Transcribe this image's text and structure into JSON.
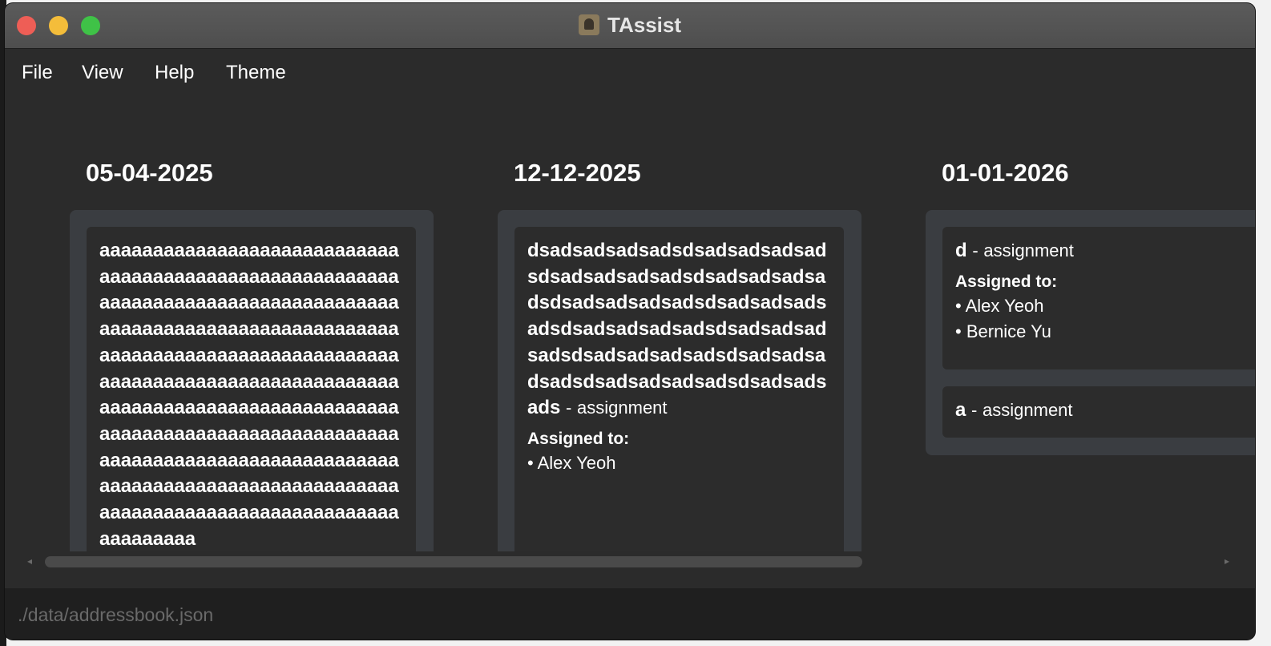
{
  "window": {
    "title": "TAssist"
  },
  "menu": [
    "File",
    "View",
    "Help",
    "Theme"
  ],
  "columns": [
    {
      "date": "05-04-2025",
      "cards": [
        {
          "name": "aaaaaaaaaaaaaaaaaaaaaaaaaaaaaaaaaaaaaaaaaaaaaaaaaaaaaaaaaaaaaaaaaaaaaaaaaaaaaaaaaaaaaaaaaaaaaaaaaaaaaaaaaaaaaaaaaaaaaaaaaaaaaaaaaaaaaaaaaaaaaaaaaaaaaaaaaaaaaaaaaaaaaaaaaaaaaaaaaaaaaaaaaaaaaaaaaaaaaaaaaaaaaaaaaaaaaaaaaaaaaaaaaaaaaaaaaaaaaaaaaaaaaaaaaaaaaaaaaaaaaaaaaaaaaaaaaaaaaaaaaaaaaaaaaaaaaaaaaaaaaaaaaaaaaaaaaaaaa"
        }
      ]
    },
    {
      "date": "12-12-2025",
      "cards": [
        {
          "name": "dsadsadsadsadsdsadsadsadsadsdsadsadsadsadsdsadsadsadsadsdsadsadsadsadsdsadsadsadsadsdsadsadsadsadsdsadsadsadsadsdsadsadsadsadsdsadsadsadsadsdsadsadsadsadsdsadsadsads",
          "type": "assignment",
          "assigned_label": "Assigned to:",
          "assignees": [
            "Alex Yeoh"
          ]
        }
      ]
    },
    {
      "date": "01-01-2026",
      "cards": [
        {
          "name": "d",
          "type": "assignment",
          "assigned_label": "Assigned to:",
          "assignees": [
            "Alex Yeoh",
            "Bernice Yu"
          ]
        },
        {
          "name": "a",
          "type": "assignment"
        }
      ]
    }
  ],
  "status": {
    "path": "./data/addressbook.json"
  },
  "icons": {
    "close": "traffic-light-red",
    "minimize": "traffic-light-yellow",
    "zoom": "traffic-light-green",
    "app": "contact-book-icon",
    "scroll_left": "◂",
    "scroll_right": "▸"
  },
  "colors": {
    "background": "#2b2b2b",
    "column": "#3a3d41",
    "card": "#2c2c2c",
    "text": "#ffffff",
    "close": "#ee5e56",
    "minimize": "#f4bd3a",
    "zoom": "#3fc247"
  }
}
